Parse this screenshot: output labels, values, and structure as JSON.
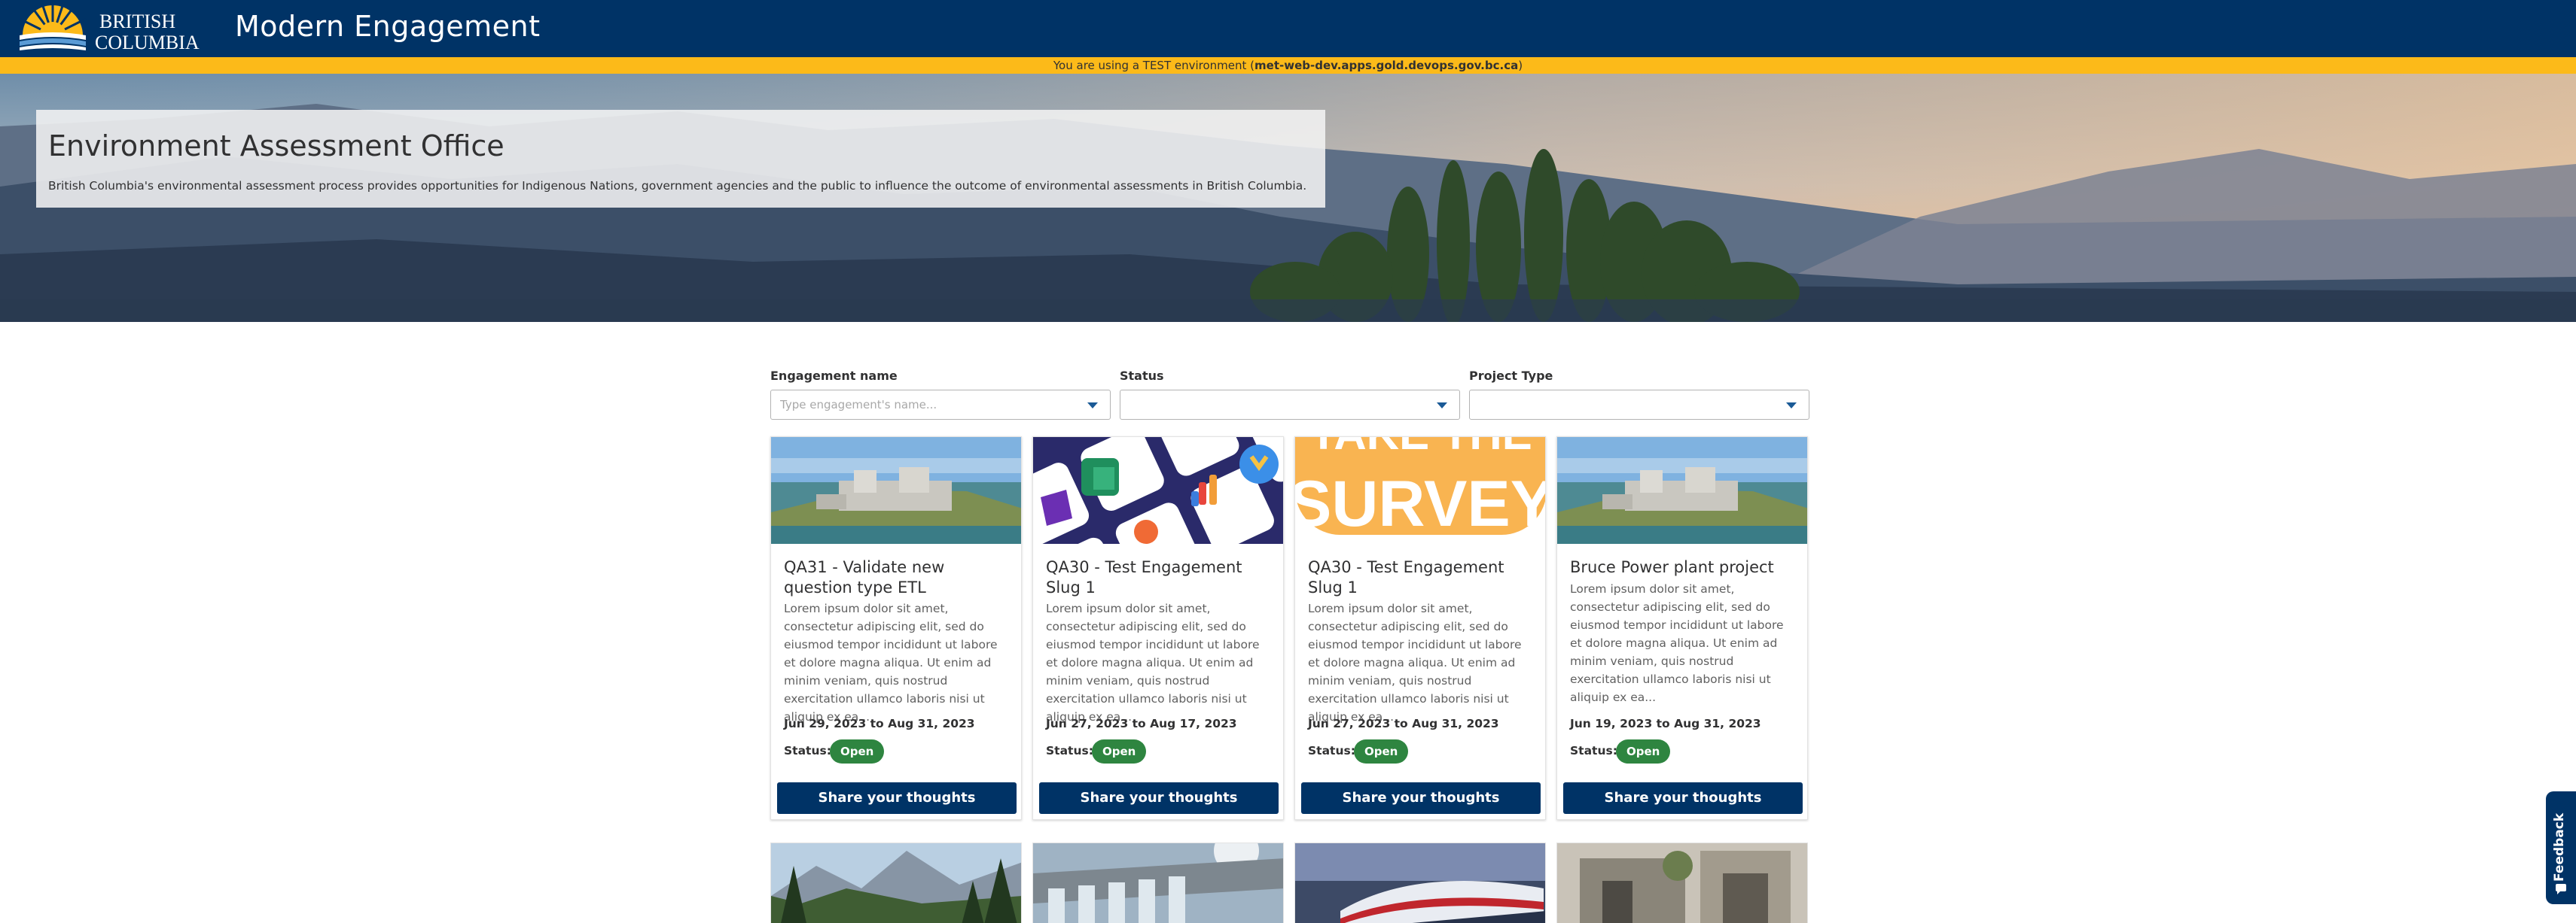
{
  "header": {
    "logo_top": "BRITISH",
    "logo_bottom": "COLUMBIA",
    "app_title": "Modern Engagement"
  },
  "env_banner": {
    "prefix": "You are using a TEST environment (",
    "host": "met-web-dev.apps.gold.devops.gov.bc.ca",
    "suffix": ")"
  },
  "hero": {
    "title": "Environment Assessment Office",
    "description": "British Columbia's environmental assessment process provides opportunities for Indigenous Nations, government agencies and the public to influence the outcome of environmental assessments in British Columbia."
  },
  "filters": {
    "name_label": "Engagement name",
    "name_placeholder": "Type engagement's name...",
    "status_label": "Status",
    "status_value": "",
    "type_label": "Project Type",
    "type_value": ""
  },
  "cards": [
    {
      "title": "QA31 - Validate new question type ETL",
      "description": "Lorem ipsum dolor sit amet, consectetur adipiscing elit, sed do eiusmod tempor incididunt ut labore et dolore magna aliqua. Ut enim ad minim veniam, quis nostrud exercitation ullamco laboris nisi ut aliquip ex ea...",
      "dates": "Jun 29, 2023 to Aug 31, 2023",
      "status_label": "Status:",
      "status": "Open",
      "button": "Share your thoughts"
    },
    {
      "title": "QA30 - Test Engagement Slug 1",
      "description": "Lorem ipsum dolor sit amet, consectetur adipiscing elit, sed do eiusmod tempor incididunt ut labore et dolore magna aliqua. Ut enim ad minim veniam, quis nostrud exercitation ullamco laboris nisi ut aliquip ex ea...",
      "dates": "Jun 27, 2023 to Aug 17, 2023",
      "status_label": "Status:",
      "status": "Open",
      "button": "Share your thoughts"
    },
    {
      "title": "QA30 - Test Engagement Slug 1",
      "description": "Lorem ipsum dolor sit amet, consectetur adipiscing elit, sed do eiusmod tempor incididunt ut labore et dolore magna aliqua. Ut enim ad minim veniam, quis nostrud exercitation ullamco laboris nisi ut aliquip ex ea...",
      "dates": "Jun 27, 2023 to Aug 31, 2023",
      "status_label": "Status:",
      "status": "Open",
      "button": "Share your thoughts",
      "image_text_top": "TAKE THE",
      "image_text_bottom": "SURVEY"
    },
    {
      "title": "Bruce Power plant project",
      "description": "Lorem ipsum dolor sit amet, consectetur adipiscing elit, sed do eiusmod tempor incididunt ut labore et dolore magna aliqua. Ut enim ad minim veniam, quis nostrud exercitation ullamco laboris nisi ut aliquip ex ea...",
      "dates": "Jun 19, 2023 to Aug 31, 2023",
      "status_label": "Status:",
      "status": "Open",
      "button": "Share your thoughts"
    }
  ],
  "feedback_label": "Feedback",
  "colors": {
    "header_bg": "#003366",
    "banner_bg": "#fcba19",
    "status_open": "#2e8540",
    "button_bg": "#003366"
  },
  "icons": [
    "bc-logo-sun-icon",
    "chevron-down-icon",
    "feedback-icon"
  ]
}
